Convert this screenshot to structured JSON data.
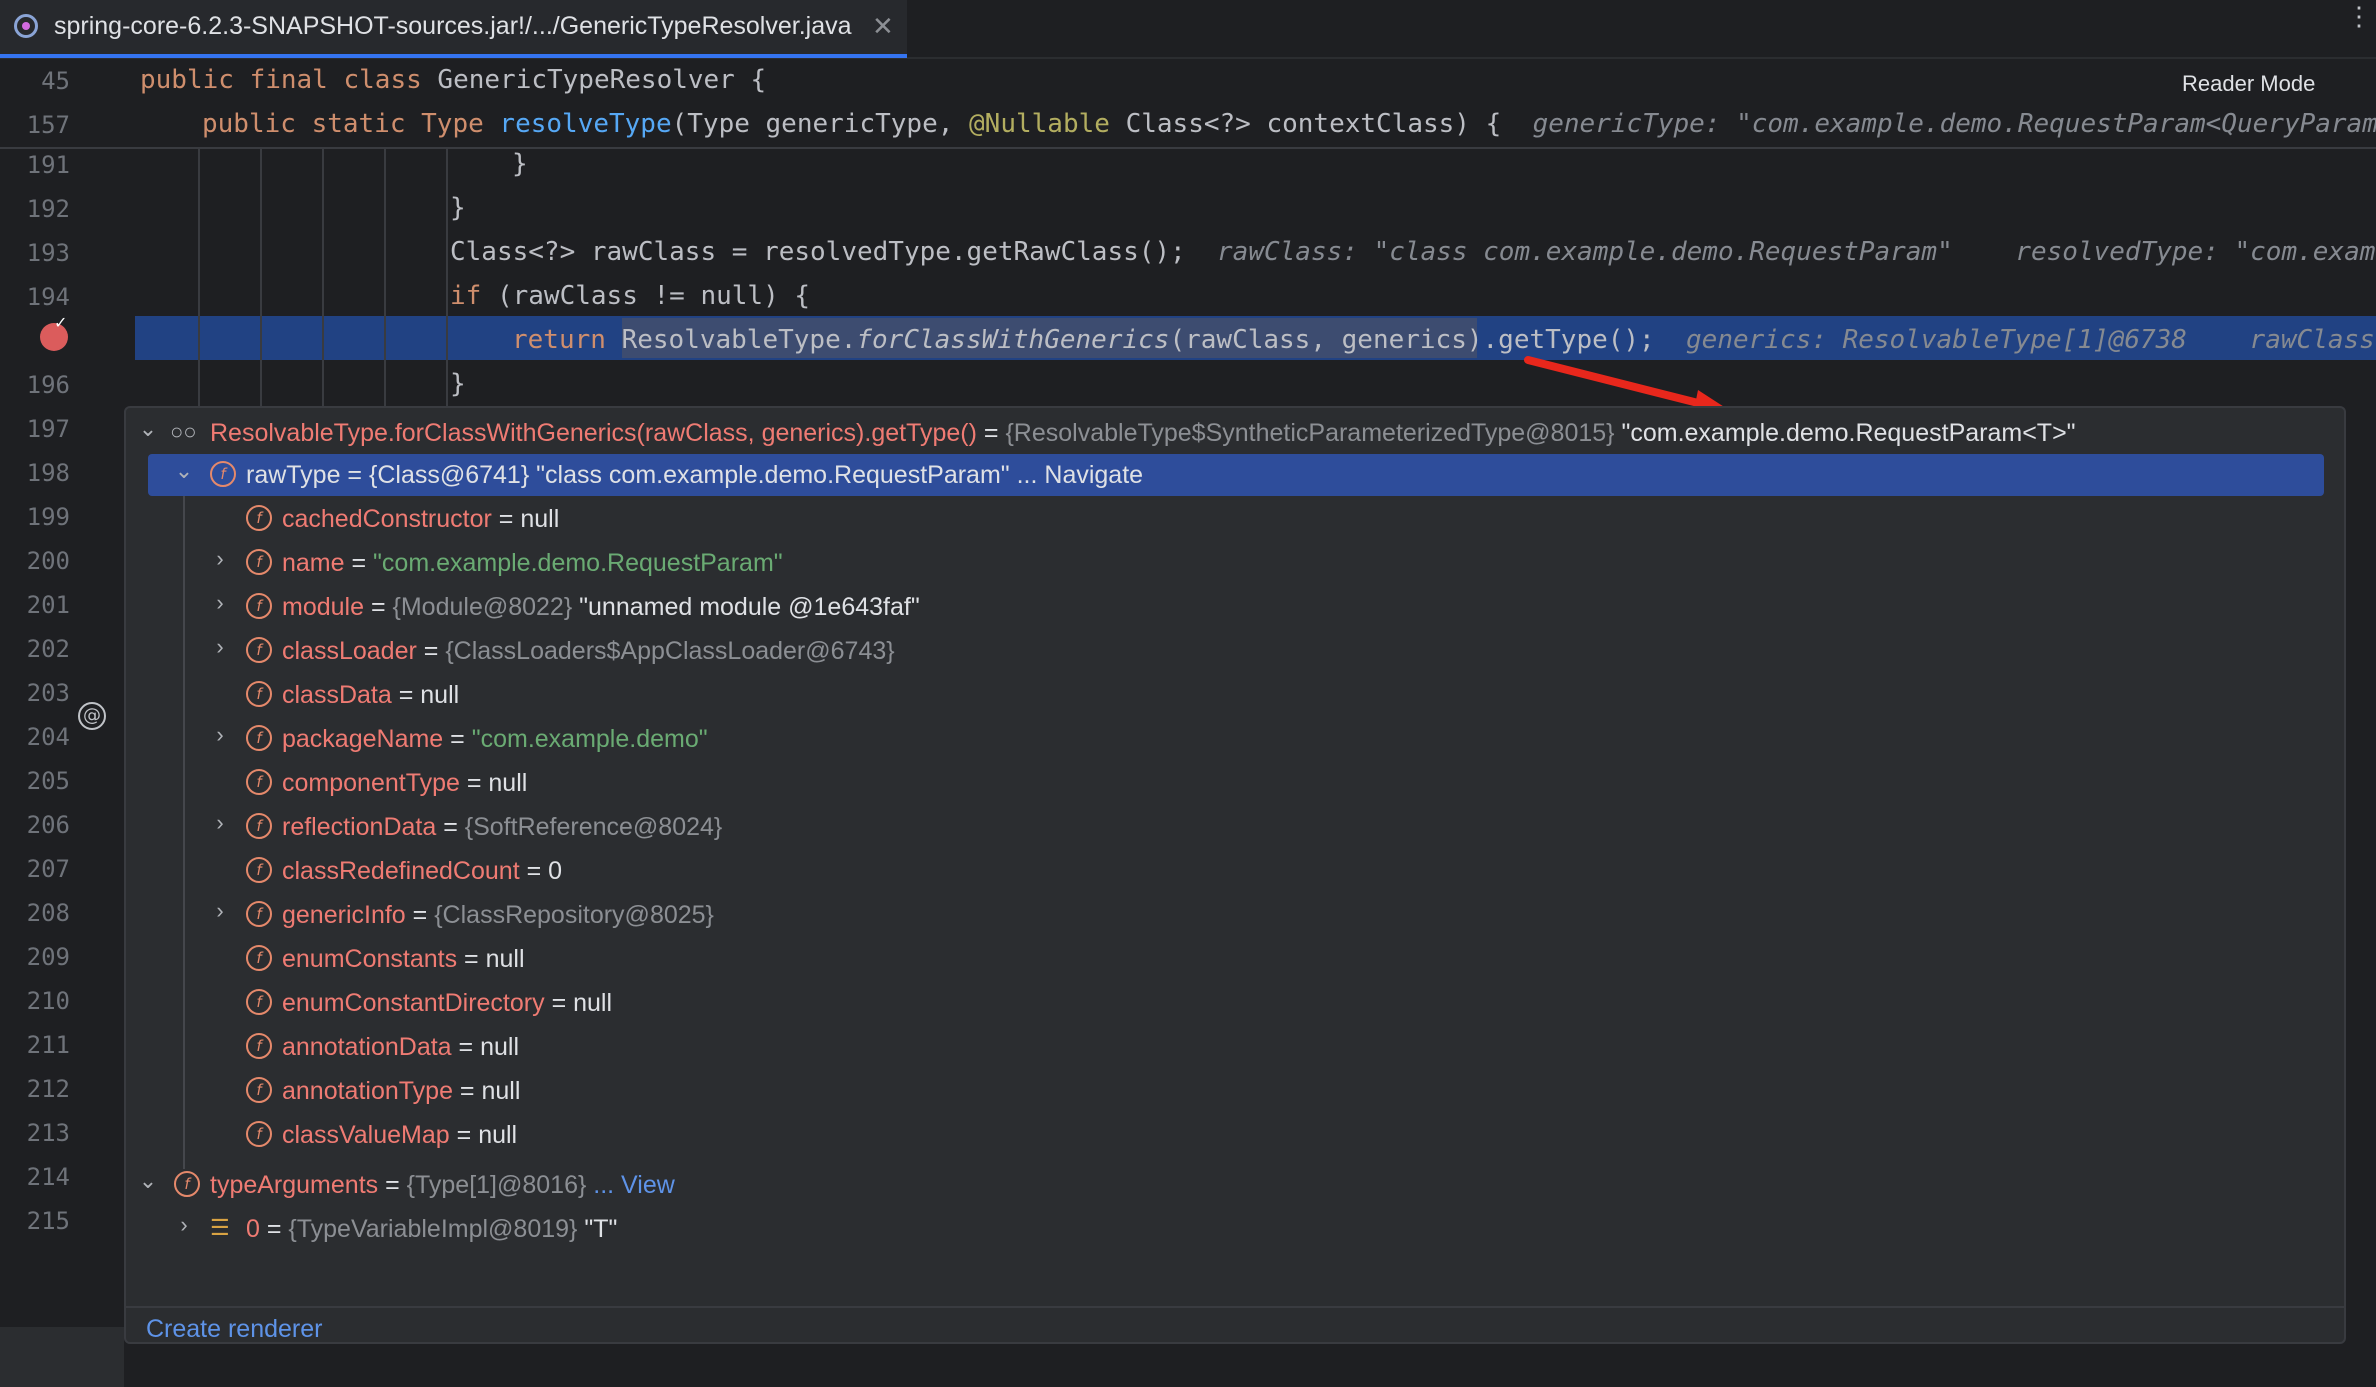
{
  "tab": {
    "title": "spring-core-6.2.3-SNAPSHOT-sources.jar!/.../GenericTypeResolver.java",
    "close": "✕",
    "more": "⋮"
  },
  "editor": {
    "reader_mode": "Reader Mode",
    "sticky": [
      {
        "no": "45",
        "pre": "public final class ",
        "name": "GenericTypeResolver",
        "post": " {"
      },
      {
        "no": "157",
        "pre": "public static Type ",
        "fn": "resolveType",
        "args1": "(Type genericType, ",
        "an": "@Nullable",
        "args2": " Class<?> contextClass) {",
        "hint": "genericType: \"com.example.demo.RequestParam<QueryParam"
      }
    ],
    "lines": [
      {
        "no": "191",
        "code": "}"
      },
      {
        "no": "192",
        "code": "}"
      },
      {
        "no": "193",
        "code": "Class<?> rawClass = resolvedType.getRawClass();",
        "hint": "rawClass: \"class com.example.demo.RequestParam\"    resolvedType: \"com.exam"
      },
      {
        "no": "194",
        "kw": "if",
        "code": " (rawClass != null) {"
      },
      {
        "no": "",
        "kw": "return",
        "code1": " ResolvableType.",
        "itfn": "forClassWithGenerics",
        "code2": "(rawClass, generics).getType();",
        "hint": "generics: ResolvableType[1]@6738    rawClass"
      },
      {
        "no": "196",
        "code": "}"
      }
    ],
    "more_line_numbers": [
      "197",
      "198",
      "199",
      "200",
      "201",
      "202",
      "203",
      "204",
      "205",
      "206",
      "207",
      "208",
      "209",
      "210",
      "211",
      "212",
      "213",
      "214",
      "215"
    ]
  },
  "popup": {
    "root": {
      "expr": "ResolvableType.forClassWithGenerics(rawClass, generics).getType()",
      "eq": " = ",
      "ref": "{ResolvableType$SyntheticParameterizedType@8015}",
      "val": " \"com.example.demo.RequestParam<T>\""
    },
    "selected": {
      "name": "rawType",
      "eq": " = ",
      "ref": "{Class@6741}",
      "val": " \"class com.example.demo.RequestParam\"",
      "link": " ... Navigate"
    },
    "fields": [
      {
        "name": "cachedConstructor",
        "value": "null",
        "kind": "plain"
      },
      {
        "name": "name",
        "value": "\"com.example.demo.RequestParam\"",
        "kind": "string",
        "exp": true
      },
      {
        "name": "module",
        "ref": "{Module@8022}",
        "value": " \"unnamed module @1e643faf\"",
        "kind": "ref",
        "exp": true
      },
      {
        "name": "classLoader",
        "ref": "{ClassLoaders$AppClassLoader@6743}",
        "value": "",
        "kind": "ref",
        "exp": true
      },
      {
        "name": "classData",
        "value": "null",
        "kind": "plain"
      },
      {
        "name": "packageName",
        "value": "\"com.example.demo\"",
        "kind": "string",
        "exp": true
      },
      {
        "name": "componentType",
        "value": "null",
        "kind": "plain"
      },
      {
        "name": "reflectionData",
        "ref": "{SoftReference@8024}",
        "value": "",
        "kind": "ref",
        "exp": true
      },
      {
        "name": "classRedefinedCount",
        "value": "0",
        "kind": "plain"
      },
      {
        "name": "genericInfo",
        "ref": "{ClassRepository@8025}",
        "value": "",
        "kind": "ref",
        "exp": true
      },
      {
        "name": "enumConstants",
        "value": "null",
        "kind": "plain"
      },
      {
        "name": "enumConstantDirectory",
        "value": "null",
        "kind": "plain"
      },
      {
        "name": "annotationData",
        "value": "null",
        "kind": "plain"
      },
      {
        "name": "annotationType",
        "value": "null",
        "kind": "plain"
      },
      {
        "name": "classValueMap",
        "value": "null",
        "kind": "plain"
      }
    ],
    "type_args": {
      "name": "typeArguments",
      "eq": " = ",
      "ref": "{Type[1]@8016}",
      "link": " ... View"
    },
    "type_arg0": {
      "name": "0",
      "eq": " = ",
      "ref": "{TypeVariableImpl@8019}",
      "val": " \"T\""
    },
    "create_renderer": "Create renderer"
  },
  "colors": {
    "accent": "#3574f0",
    "selection": "#2e4d9b",
    "exec_line": "#214283",
    "arrow": "#e8271c"
  }
}
